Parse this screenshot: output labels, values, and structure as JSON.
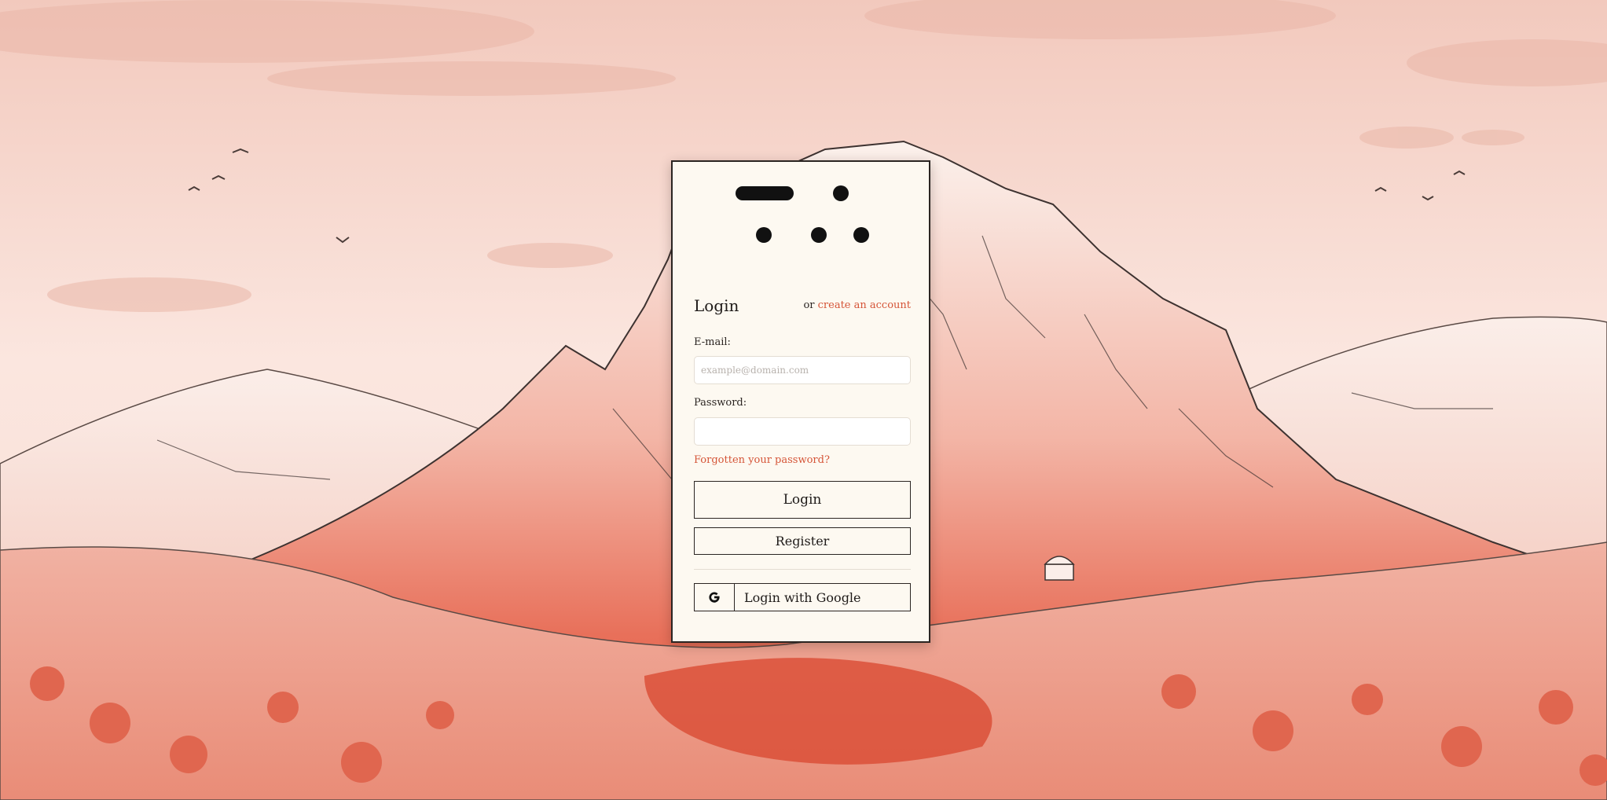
{
  "colors": {
    "accent": "#d55538",
    "card_bg": "#fdf9f1",
    "border": "#2b2522",
    "sky": "#f5d3ca",
    "mountain_red": "#e0604a"
  },
  "login": {
    "title": "Login",
    "alt_prefix": "or",
    "create_account": "create an account",
    "email_label": "E-mail:",
    "email_placeholder": "example@domain.com",
    "password_label": "Password:",
    "forgot": "Forgotten your password?",
    "login_button": "Login",
    "register_button": "Register",
    "google_button": "Login with Google",
    "google_icon": "google-icon"
  },
  "logo": {
    "icon": "logo-dots-icon"
  }
}
